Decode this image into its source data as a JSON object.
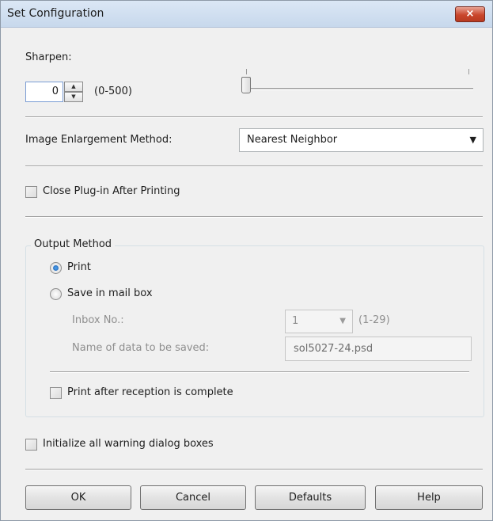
{
  "window": {
    "title": "Set Configuration",
    "close_glyph": "×"
  },
  "sharpen": {
    "label": "Sharpen:",
    "value": "0",
    "range": "(0-500)",
    "slider_level": 0
  },
  "enlargement": {
    "label": "Image Enlargement Method:",
    "selected": "Nearest Neighbor",
    "arrow_glyph": "▼"
  },
  "close_plugin": {
    "label": "Close Plug-in After Printing",
    "checked": false
  },
  "output_method": {
    "group_label": "Output Method",
    "print_label": "Print",
    "save_label": "Save in mail box",
    "selected": "Print",
    "inbox_label": "Inbox No.:",
    "inbox_value": "1",
    "inbox_range": "(1-29)",
    "name_label": "Name of data to be saved:",
    "name_value": "sol5027-24.psd",
    "print_after_label": "Print after reception is complete",
    "print_after_checked": false
  },
  "init_warnings": {
    "label": "Initialize all warning dialog boxes",
    "checked": false
  },
  "buttons": {
    "ok": "OK",
    "cancel": "Cancel",
    "defaults": "Defaults",
    "help": "Help"
  },
  "colors": {
    "titlebar": "#c7d8ec",
    "close": "#c9462c",
    "radio_selected": "#1e5fae"
  }
}
